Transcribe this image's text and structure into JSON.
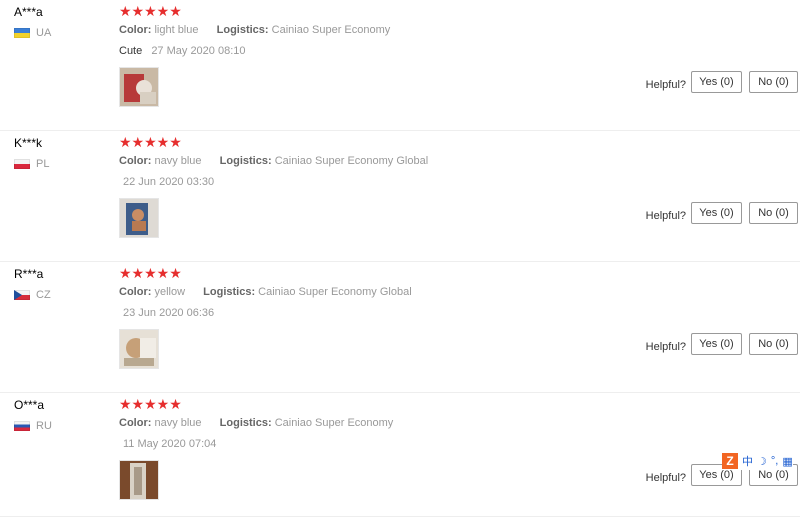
{
  "helpful_label": "Helpful?",
  "yes_label": "Yes (0)",
  "no_label": "No (0)",
  "reviews": [
    {
      "user": "A***a",
      "country": "UA",
      "stars": "★★★★★",
      "rating": 5,
      "color_key": "Color:",
      "color_value": "light blue",
      "logistics_key": "Logistics:",
      "logistics_value": "Cainiao Super Economy",
      "feedback": "Cute",
      "date": "27 May 2020 08:10"
    },
    {
      "user": "K***k",
      "country": "PL",
      "stars": "★★★★★",
      "rating": 5,
      "color_key": "Color:",
      "color_value": "navy blue",
      "logistics_key": "Logistics:",
      "logistics_value": "Cainiao Super Economy Global",
      "date": "22 Jun 2020 03:30"
    },
    {
      "user": "R***a",
      "country": "CZ",
      "stars": "★★★★★",
      "rating": 5,
      "color_key": "Color:",
      "color_value": "yellow",
      "logistics_key": "Logistics:",
      "logistics_value": "Cainiao Super Economy Global",
      "date": "23 Jun 2020 06:36"
    },
    {
      "user": "O***a",
      "country": "RU",
      "stars": "★★★★★",
      "rating": 5,
      "color_key": "Color:",
      "color_value": "navy blue",
      "logistics_key": "Logistics:",
      "logistics_value": "Cainiao Super Economy",
      "date": "11 May 2020 07:04"
    }
  ],
  "ime": {
    "logo": "Z",
    "mode": "中",
    "moon": "☽",
    "punct": "°,",
    "grid": "▦"
  },
  "colors": {
    "star": "#e62e2e",
    "muted": "#999999",
    "ime_accent": "#f26522",
    "ime_text": "#1f5fd1"
  }
}
